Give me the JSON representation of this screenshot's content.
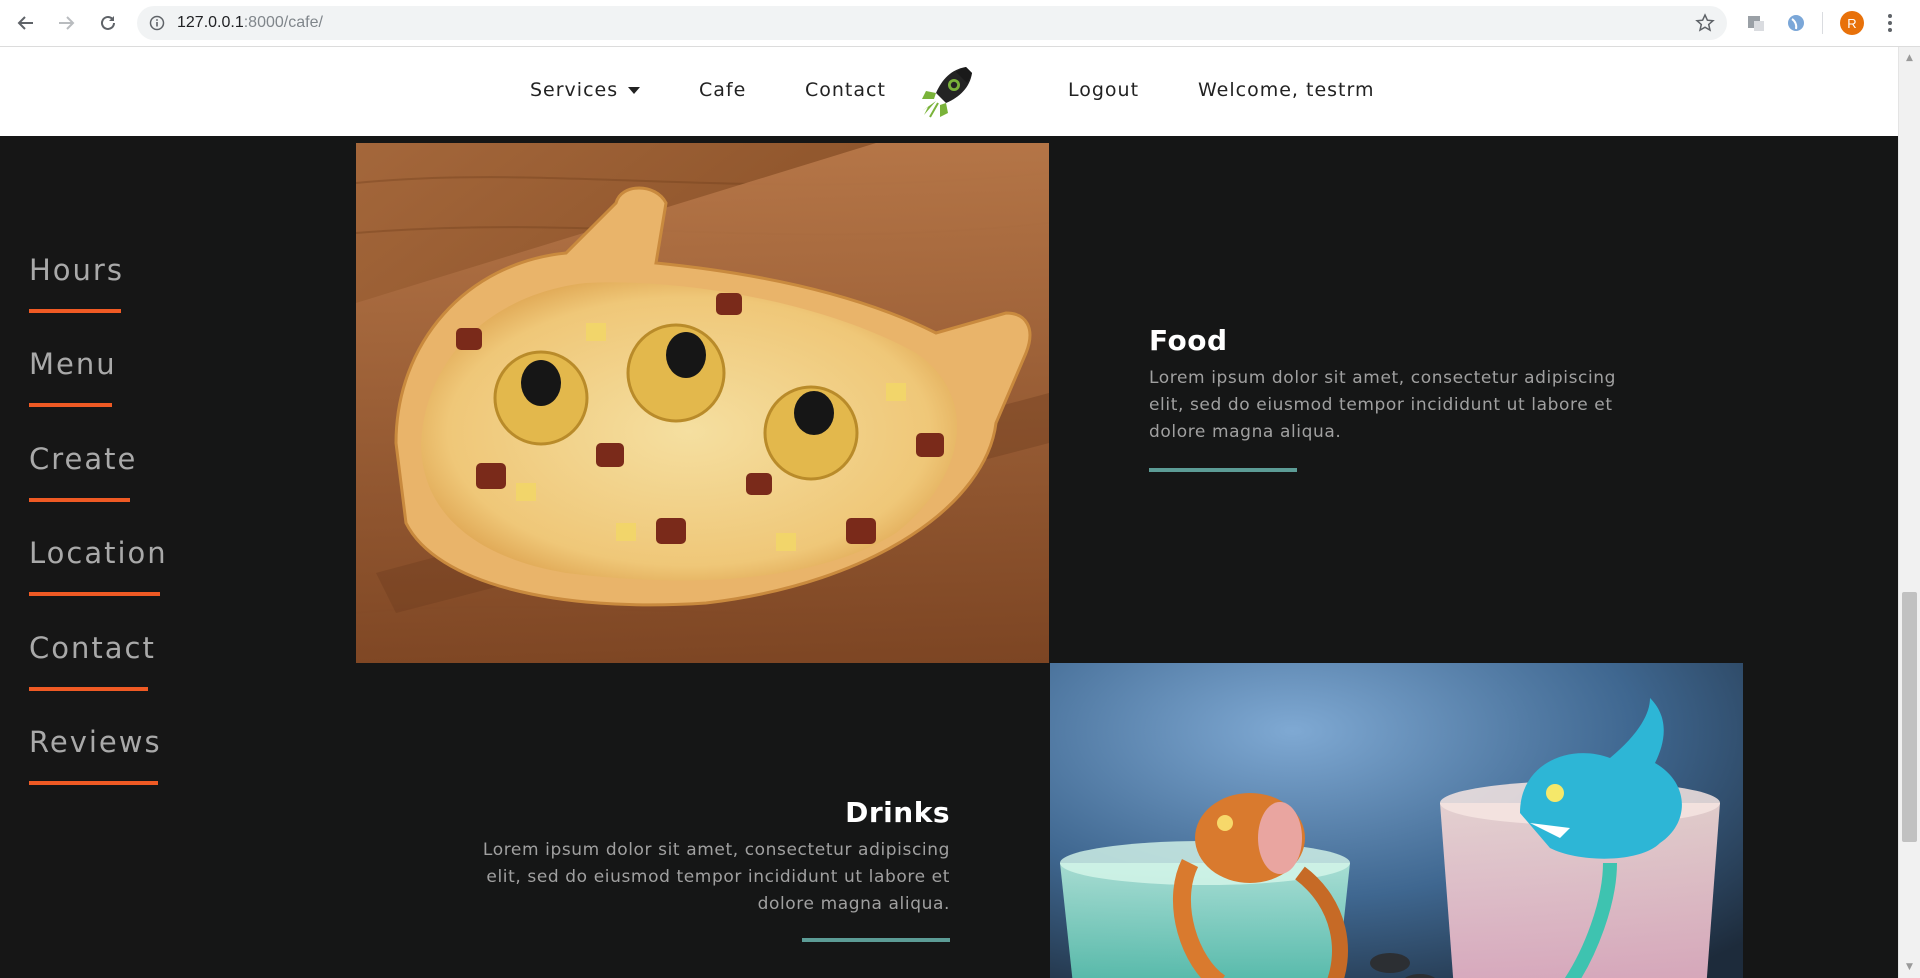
{
  "browser": {
    "url_host": "127.0.0.1",
    "url_rest": ":8000/cafe/",
    "profile_initial": "R"
  },
  "nav": {
    "services": "Services",
    "cafe": "Cafe",
    "contact": "Contact",
    "logout": "Logout",
    "welcome": "Welcome, testrm"
  },
  "sidebar": {
    "items": [
      {
        "label": "Hours"
      },
      {
        "label": "Menu"
      },
      {
        "label": "Create"
      },
      {
        "label": "Location"
      },
      {
        "label": "Contact"
      },
      {
        "label": "Reviews"
      }
    ]
  },
  "sections": {
    "food": {
      "title": "Food",
      "body": "Lorem ipsum dolor sit amet, consectetur adipiscing elit, sed do eiusmod tempor incididunt ut labore et dolore magna aliqua."
    },
    "drinks": {
      "title": "Drinks",
      "body": "Lorem ipsum dolor sit amet, consectetur adipiscing elit, sed do eiusmod tempor incididunt ut labore et dolore magna aliqua."
    }
  },
  "colors": {
    "accent_orange": "#ef5a24",
    "accent_teal": "#5c9c96",
    "page_bg": "#141414"
  },
  "icons": {
    "back": "arrow-left-icon",
    "forward": "arrow-right-icon",
    "reload": "reload-icon",
    "site_info": "info-icon",
    "bookmark": "star-icon",
    "logo": "rocket-icon"
  }
}
